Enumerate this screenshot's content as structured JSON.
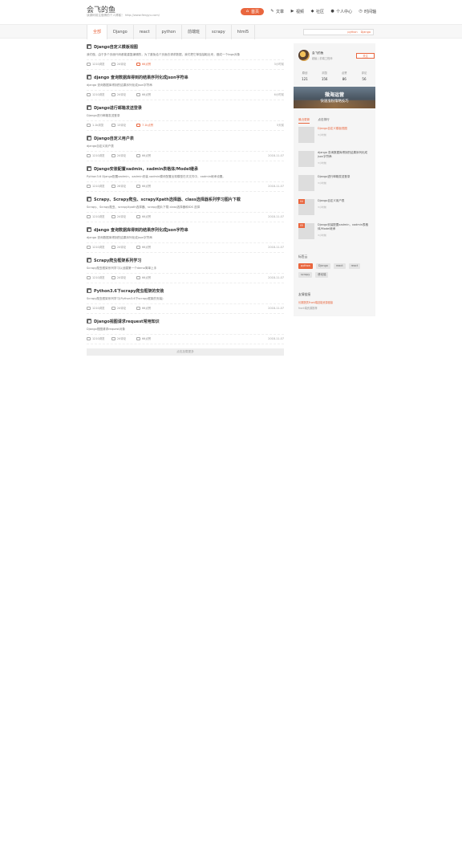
{
  "site": {
    "title": "会飞的鱼",
    "subtitle": "读源码前注做博的个人博客！ http://www.fengyu.com/"
  },
  "nav": [
    {
      "label": "首页",
      "icon": "home-icon",
      "glyph": "⌂",
      "active": true
    },
    {
      "label": "文章",
      "icon": "article-icon",
      "glyph": "✎",
      "active": false
    },
    {
      "label": "视频",
      "icon": "video-icon",
      "glyph": "▶",
      "active": false
    },
    {
      "label": "社区",
      "icon": "community-icon",
      "glyph": "◆",
      "active": false
    },
    {
      "label": "个人中心",
      "icon": "user-icon",
      "glyph": "●",
      "active": false
    },
    {
      "label": "时间轴",
      "icon": "clock-icon",
      "glyph": "◷",
      "active": false
    }
  ],
  "categories": [
    "全部",
    "Django",
    "react",
    "python",
    "前端班",
    "scrapy",
    "html5"
  ],
  "search": {
    "placeholder": "",
    "hot_tags": [
      "python",
      "Django"
    ]
  },
  "articles": [
    {
      "title": "Django自定义模板视图",
      "summary": "我们做，由于多个页面代码都能重复编辑的，为了避免给个页面去请求数据，我们把它单独抽取出来，做成一个tags对象",
      "views": "1210浏览",
      "comments": "24评论",
      "likes": "66点赞",
      "date": "3小时前",
      "hot": true
    },
    {
      "title": "django 查询数据库得到的结果序列化成json字符串",
      "summary": "django 查询数据库得到的结果序列化成json字符串",
      "views": "1210浏览",
      "comments": "24评论",
      "likes": "66点赞",
      "date": "6小时前",
      "hot": false
    },
    {
      "title": "Django进行邮箱发送登录",
      "summary": "Django进行邮箱发送登录",
      "views": "1.1k浏览",
      "comments": "13评论",
      "likes": "7.1k点赞",
      "date": "5天前",
      "hot": true
    },
    {
      "title": "Django自定义用户表",
      "summary": "django自定义用户表",
      "views": "1210浏览",
      "comments": "24评论",
      "likes": "66点赞",
      "date": "2018-11-07",
      "hot": false
    },
    {
      "title": "Django安装配置xadmin，xadmin表格体/Model继承",
      "summary": "Python3.6 Django配置xadmin，xadmin安装 xadmin模块配置出现模型在次文件中，xadmin继承设置。",
      "views": "1210浏览",
      "comments": "26评论",
      "likes": "66点赞",
      "date": "2018-11-07",
      "hot": false
    },
    {
      "title": "Scrapy、Scrapy爬虫、scrapyXpath选择器、class选择器系列学习图片下载",
      "summary": "Scrapy、Scrapy爬虫、scrapyXpath选择器、scrapy图片下载 class选择器和IDS 选择",
      "views": "1210浏览",
      "comments": "24评论",
      "likes": "66点赞",
      "date": "2018-11-07",
      "hot": false
    },
    {
      "title": "django 查询数据库得到的结果序列化成json字符串",
      "summary": "django 查询数据库得到的结果序列化成json字符串",
      "views": "1210浏览",
      "comments": "24评论",
      "likes": "66点赞",
      "date": "2018-11-07",
      "hot": false
    },
    {
      "title": "Scrapy爬虫框架系列学习",
      "summary": "Scrapy爬虫框架系列学习以创建第一个demo简单上手",
      "views": "1210浏览",
      "comments": "24评论",
      "likes": "66点赞",
      "date": "2018-11-07",
      "hot": false
    },
    {
      "title": "Python3.6下scrapy爬虫框架的安装",
      "summary": "Scrapy爬虫框架系列学习(Python3.6下scrapy框架的安装)",
      "views": "1210浏览",
      "comments": "24评论",
      "likes": "66点赞",
      "date": "2018-11-07",
      "hot": false
    },
    {
      "title": "Django视图请求request常用知识",
      "summary": "Django视图请求request对象",
      "views": "1210浏览",
      "comments": "24评论",
      "likes": "66点赞",
      "date": "2018-11-07",
      "hot": false
    }
  ],
  "load_more": "点击加载更多",
  "sidebar": {
    "profile": {
      "name": "会飞的鱼",
      "role": "超级 | 前端工程师",
      "follow": "关注"
    },
    "stats": [
      {
        "label": "原创",
        "value": "121"
      },
      {
        "label": "浏览",
        "value": "156"
      },
      {
        "label": "点赞",
        "value": "86"
      },
      {
        "label": "评论",
        "value": "56"
      }
    ],
    "banner": {
      "line1": "微海运营",
      "line2": "快速涨粉策略技巧"
    },
    "tabs": [
      {
        "label": "最近更新",
        "active": true
      },
      {
        "label": "点击排行",
        "active": false
      }
    ],
    "recent": [
      {
        "title": "Django自定义模板视图",
        "date": "3小时前",
        "num": ""
      },
      {
        "title": "django 查询数据库得到的结果序列化成json字符串",
        "date": "3小时前",
        "num": ""
      },
      {
        "title": "Django进行邮箱发送登录",
        "date": "3小时前",
        "num": ""
      },
      {
        "title": "Django自定义用户表",
        "date": "3小时前",
        "num": "04"
      },
      {
        "title": "Django安装配置xadmin，xadmin表格体/Model继承",
        "date": "3小时前",
        "num": "05"
      }
    ],
    "tags_label": "标签云",
    "tags": [
      {
        "label": "python",
        "active": true
      },
      {
        "label": "Django",
        "active": false
      },
      {
        "label": "react",
        "active": false
      },
      {
        "label": "react",
        "active": false
      },
      {
        "label": "scrapy",
        "active": false
      },
      {
        "label": "移动端",
        "active": false
      }
    ],
    "links_label": "友情链接",
    "links": [
      {
        "label": "长期提供Front端技能资源链接",
        "gray": false
      },
      {
        "label": "front端资源推荐",
        "gray": true
      }
    ]
  }
}
